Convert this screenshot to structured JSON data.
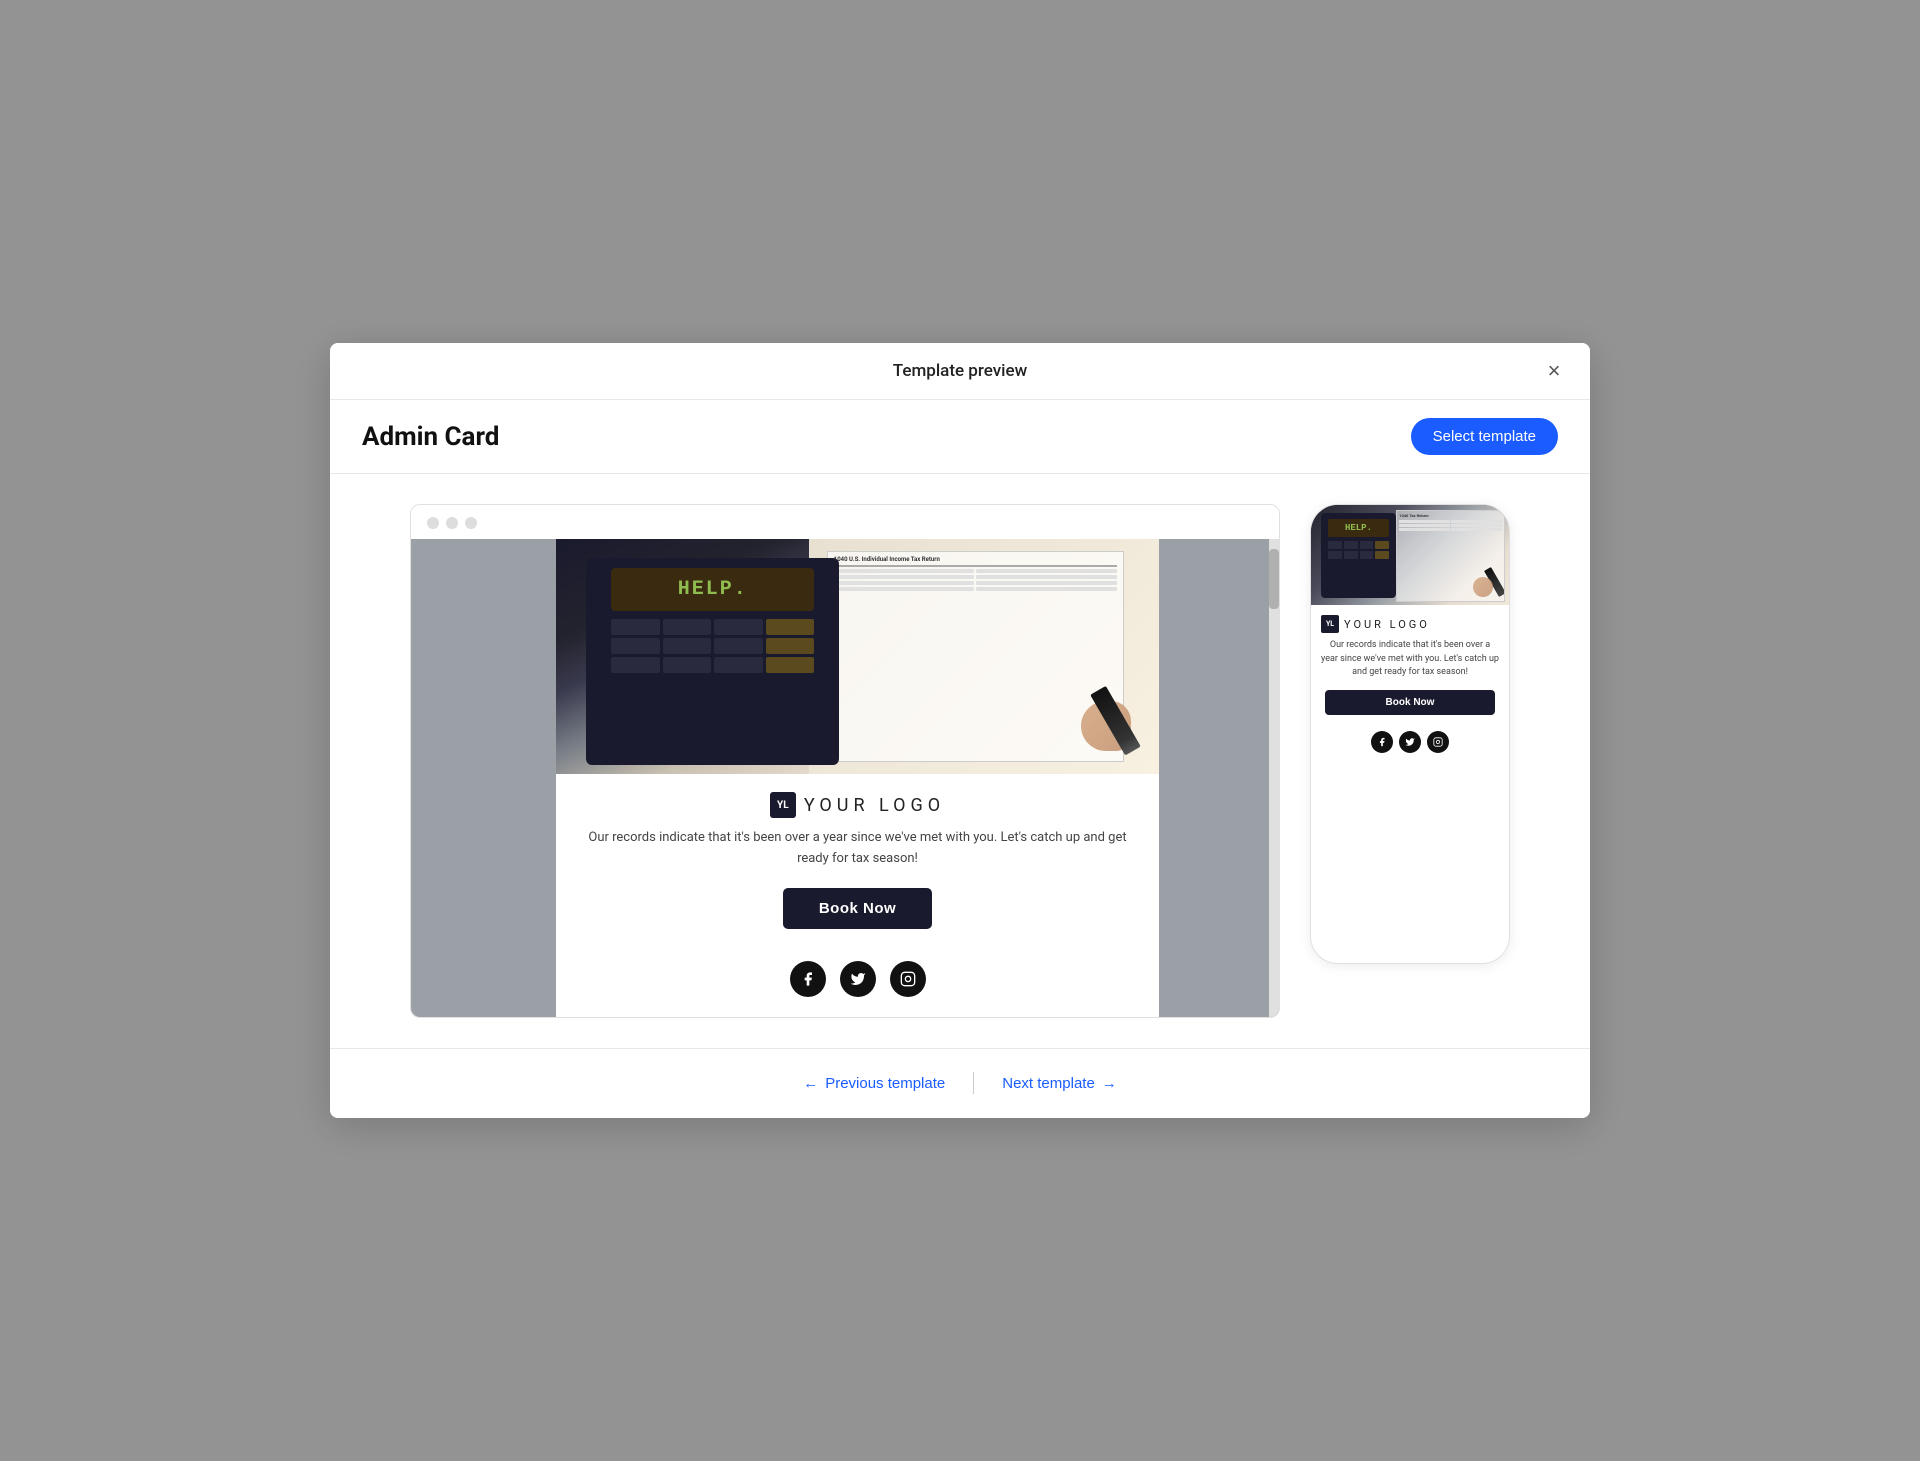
{
  "modal": {
    "title": "Template preview",
    "close_label": "×",
    "template_name": "Admin Card",
    "select_btn": "Select template"
  },
  "browser_dots": [
    "dot1",
    "dot2",
    "dot3"
  ],
  "email": {
    "hero_calculator_text": "HELP.",
    "logo_initials": "YL",
    "logo_text": "YOUR LOGO",
    "body_text": "Our records indicate that it's been over a year since we've met with you. Let's catch up and get ready for tax season!",
    "book_btn": "Book Now",
    "social": [
      "f",
      "t",
      "i"
    ]
  },
  "mobile": {
    "logo_initials": "YL",
    "logo_text": "YOUR LOGO",
    "body_text": "Our records indicate that it's been over a year since we've met with you. Let's catch up and get ready for tax season!",
    "book_btn": "Book Now",
    "social": [
      "f",
      "t",
      "i"
    ]
  },
  "footer": {
    "prev_label": "Previous template",
    "next_label": "Next template",
    "prev_arrow": "←",
    "next_arrow": "→"
  }
}
